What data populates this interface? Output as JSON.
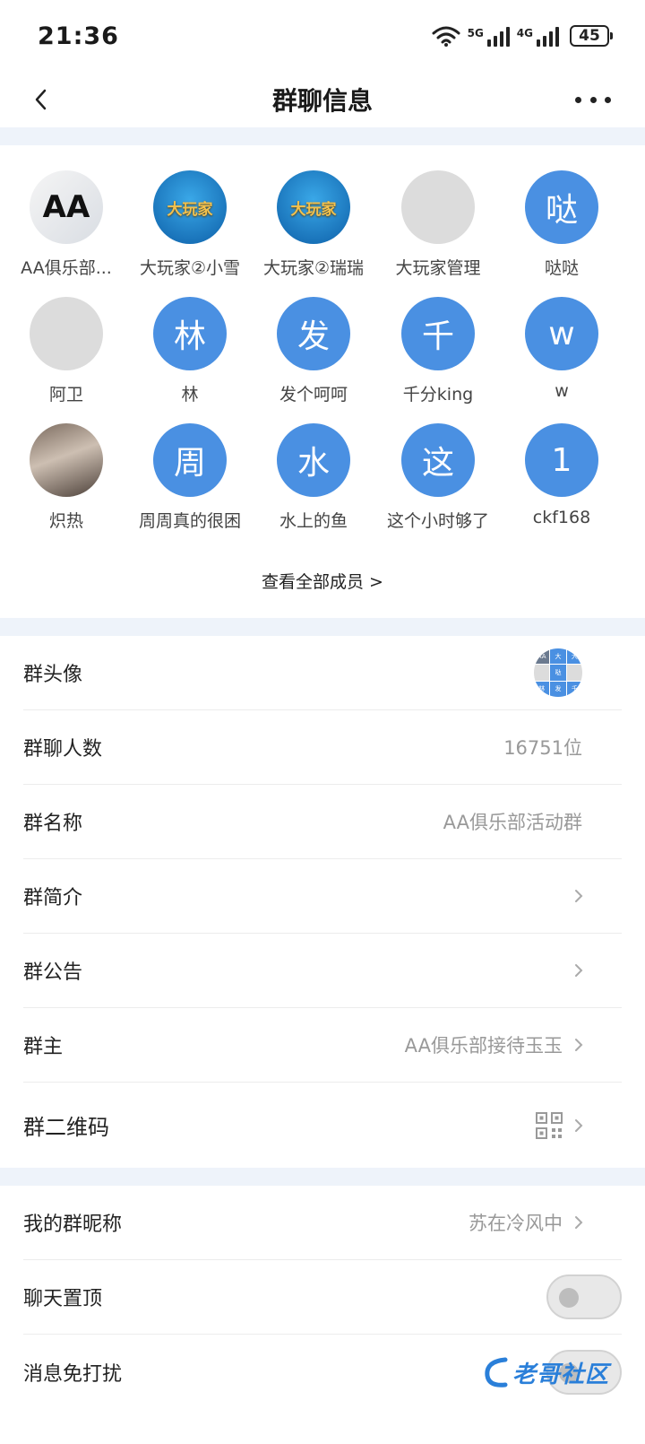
{
  "status_bar": {
    "time": "21:36",
    "signal_5g": "5G",
    "signal_4g": "4G",
    "battery": "45"
  },
  "nav": {
    "title": "群聊信息"
  },
  "members": [
    {
      "name": "AA俱乐部...",
      "avatar": "AA",
      "style": "photo-cards"
    },
    {
      "name": "大玩家②小雪",
      "avatar": "大玩家",
      "style": "logo"
    },
    {
      "name": "大玩家②瑞瑞",
      "avatar": "大玩家",
      "style": "logo"
    },
    {
      "name": "大玩家管理",
      "avatar": "",
      "style": "gray"
    },
    {
      "name": "哒哒",
      "avatar": "哒",
      "style": "blue"
    },
    {
      "name": "阿卫",
      "avatar": "",
      "style": "gray"
    },
    {
      "name": "林",
      "avatar": "林",
      "style": "blue"
    },
    {
      "name": "发个呵呵",
      "avatar": "发",
      "style": "blue"
    },
    {
      "name": "千分king",
      "avatar": "千",
      "style": "blue"
    },
    {
      "name": "w",
      "avatar": "w",
      "style": "blue"
    },
    {
      "name": "炽热",
      "avatar": "",
      "style": "photo"
    },
    {
      "name": "周周真的很困",
      "avatar": "周",
      "style": "blue"
    },
    {
      "name": "水上的鱼",
      "avatar": "水",
      "style": "blue"
    },
    {
      "name": "这个小时够了",
      "avatar": "这",
      "style": "blue"
    },
    {
      "name": "ckf168",
      "avatar": "1",
      "style": "blue"
    }
  ],
  "view_all_label": "查看全部成员 >",
  "group_info": {
    "avatar_label": "群头像",
    "member_count_label": "群聊人数",
    "member_count_value": "16751位",
    "name_label": "群名称",
    "name_value": "AA俱乐部活动群",
    "intro_label": "群简介",
    "notice_label": "群公告",
    "owner_label": "群主",
    "owner_value": "AA俱乐部接待玉玉",
    "qrcode_label": "群二维码"
  },
  "personal": {
    "nickname_label": "我的群昵称",
    "nickname_value": "苏在冷风中",
    "pin_label": "聊天置顶",
    "pin_on": false,
    "mute_label": "消息免打扰",
    "mute_on": false
  },
  "watermark": {
    "text": "老哥社区"
  },
  "colors": {
    "accent_blue": "#4a90e2",
    "section_gap": "#eef3fa"
  }
}
